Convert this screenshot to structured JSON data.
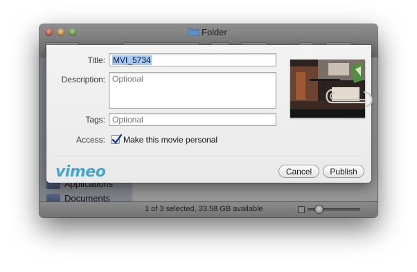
{
  "finder": {
    "window_title": "Folder",
    "sidebar": {
      "items": [
        {
          "label": "Applications"
        },
        {
          "label": "Documents"
        }
      ]
    },
    "status_text": "1 of 3 selected, 33.58 GB available"
  },
  "sheet": {
    "title": {
      "label": "Title:",
      "value": "MVI_5734"
    },
    "description": {
      "label": "Description:",
      "placeholder": "Optional"
    },
    "tags": {
      "label": "Tags:",
      "placeholder": "Optional"
    },
    "access": {
      "label": "Access:",
      "checkbox_label": "Make this movie personal",
      "checked": true
    },
    "logo_text": "vimeo",
    "buttons": {
      "cancel": "Cancel",
      "publish": "Publish"
    }
  },
  "colors": {
    "vimeo_brand": "#3fa7cf",
    "selection": "#a9c8f0"
  }
}
